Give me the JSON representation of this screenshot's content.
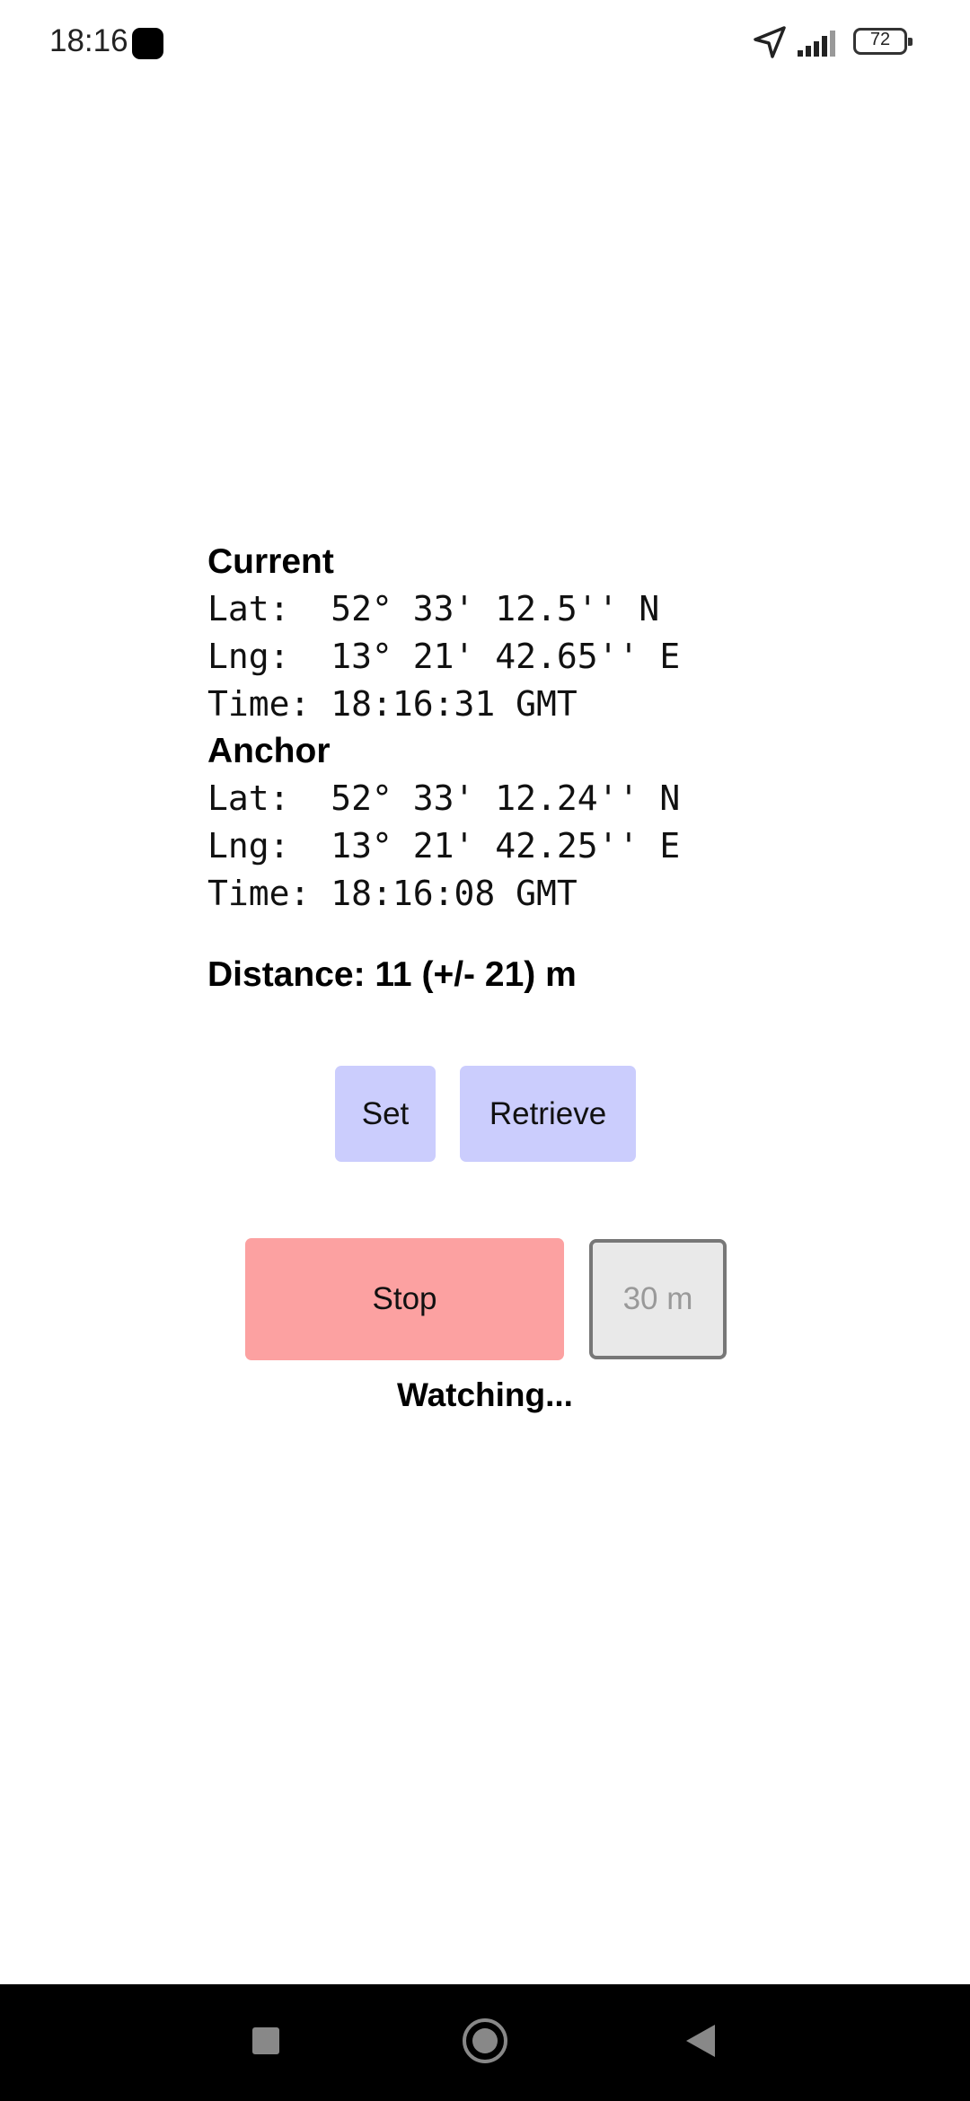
{
  "status_bar": {
    "time": "18:16",
    "battery_level": "72",
    "icons": [
      "navigation-arrow-icon",
      "signal-icon",
      "battery-icon"
    ]
  },
  "current": {
    "heading": "Current",
    "lat": "Lat:  52° 33' 12.5'' N",
    "lng": "Lng:  13° 21' 42.65'' E",
    "time": "Time: 18:16:31 GMT"
  },
  "anchor": {
    "heading": "Anchor",
    "lat": "Lat:  52° 33' 12.24'' N",
    "lng": "Lng:  13° 21' 42.25'' E",
    "time": "Time: 18:16:08 GMT"
  },
  "distance": "Distance: 11 (+/- 21) m",
  "buttons": {
    "set": "Set",
    "retrieve": "Retrieve",
    "stop": "Stop"
  },
  "radius": {
    "value": "30 m"
  },
  "status": "Watching...",
  "colors": {
    "anchor_button": "#cbcdfd",
    "stop_button": "#fca1a1",
    "radius_field": "#e9e9e9"
  },
  "nav_bar": {
    "icons": [
      "recents-icon",
      "home-icon",
      "back-icon"
    ]
  }
}
